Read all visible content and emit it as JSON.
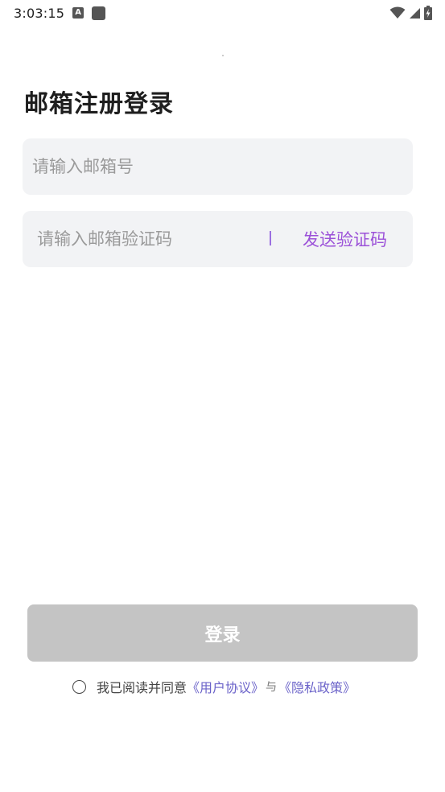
{
  "status_bar": {
    "time": "3:03:15",
    "notif_letter": "A"
  },
  "page": {
    "title": "邮箱注册登录"
  },
  "email_field": {
    "placeholder": "请输入邮箱号",
    "value": ""
  },
  "code_field": {
    "placeholder": "请输入邮箱验证码",
    "value": "",
    "send_label": "发送验证码"
  },
  "login_button": {
    "label": "登录"
  },
  "agreement": {
    "checked": false,
    "prefix": "我已阅读并同意",
    "user_agreement": "《用户协议》",
    "and": "与",
    "privacy_policy": "《隐私政策》"
  },
  "colors": {
    "accent": "#9b50d8",
    "link": "#6b63c9",
    "field_bg": "#f2f3f5",
    "button_disabled": "#c4c4c4"
  }
}
